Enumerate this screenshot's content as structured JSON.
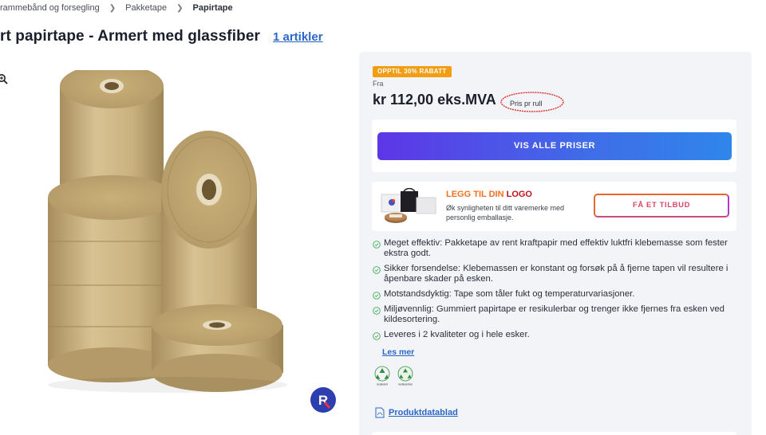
{
  "breadcrumb": {
    "items": [
      "rammebånd og forsegling",
      "Pakketape",
      "Papirtape"
    ]
  },
  "header": {
    "title": "rt papirtape - Armert med glassfiber",
    "article_count": "1 artikler"
  },
  "product": {
    "discount_badge": "OPPTIL 30% RABATT",
    "from_label": "Fra",
    "price": "kr 112,00 eks.MVA",
    "unit_note": "Pris pr rull",
    "price_button": "VIS ALLE PRISER"
  },
  "logo_offer": {
    "title_prefix": "LEGG TIL DIN",
    "title_suffix": "LOGO",
    "description": "Øk synligheten til ditt varemerke med personlig emballasje.",
    "button": "FÅ ET TILBUD"
  },
  "features": [
    "Meget effektiv: Pakketape av rent kraftpapir med effektiv luktfri klebemasse som fester ekstra godt.",
    "Sikker forsendelse: Klebemassen er konstant og forsøk på å fjerne tapen vil resultere i åpenbare skader på esken.",
    "Motstandsdyktig: Tape som tåler fukt og temperaturvariasjoner.",
    "Miljøvennlig: Gummiert papirtape er resikulerbar og trenger ikke fjernes fra esken ved kildesortering.",
    "Leveres i 2 kvaliteter og i hele esker."
  ],
  "read_more": "Les mer",
  "certifications": {
    "icon_1": "recycle-icon",
    "icon_1_label": "resikulert",
    "icon_2": "recyclable-icon",
    "icon_2_label": "resikulerbar"
  },
  "datasheet": {
    "label": "Produktdatablad",
    "icon": "pdf-icon"
  },
  "colors": {
    "accent_blue": "#2a67c9",
    "badge_orange": "#f29d12",
    "button_gradient_start": "#5d36e6",
    "button_gradient_end": "#2f86ea",
    "check_green": "#3daa57"
  }
}
